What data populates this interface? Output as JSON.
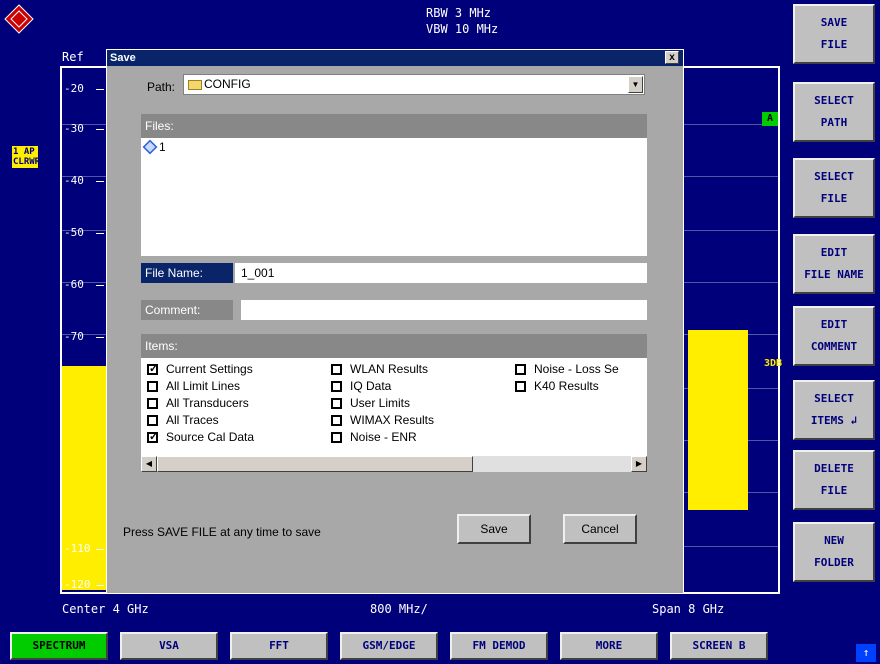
{
  "colors": {
    "screen_bg": "#00007a",
    "trace": "#ffee00",
    "dialog_bg": "#a8a8a8",
    "title_bar": "#0a246a",
    "active_tab": "#00cc00"
  },
  "header": {
    "rbw": "RBW 3 MHz",
    "vbw": "VBW 10 MHz",
    "ref": "Ref"
  },
  "y_ticks": [
    "-20",
    "-30",
    "-40",
    "-50",
    "-60",
    "-70",
    "-110",
    "-120"
  ],
  "badges": {
    "trace": "1 AP\nCLRWR",
    "marker_a": "A",
    "db": "3DB"
  },
  "footer": {
    "center": "Center  4 GHz",
    "span_per_div": "800 MHz/",
    "span": "Span  8 GHz"
  },
  "softkeys": [
    {
      "line1": "SAVE",
      "line2": "FILE"
    },
    {
      "line1": "SELECT",
      "line2": "PATH"
    },
    {
      "line1": "SELECT",
      "line2": "FILE"
    },
    {
      "line1": "EDIT",
      "line2": "FILE NAME"
    },
    {
      "line1": "EDIT",
      "line2": "COMMENT"
    },
    {
      "line1": "SELECT",
      "line2": "ITEMS  ↲"
    },
    {
      "line1": "DELETE",
      "line2": "FILE"
    },
    {
      "line1": "NEW",
      "line2": "FOLDER"
    }
  ],
  "hotkeys": [
    "SPECTRUM",
    "VSA",
    "FFT",
    "GSM/EDGE",
    "FM DEMOD",
    "MORE",
    "SCREEN B"
  ],
  "corner_icon": "up-arrow-icon",
  "dialog": {
    "title": "Save",
    "close": "x",
    "path_label": "Path:",
    "path_value": "CONFIG",
    "files_header": "Files:",
    "files": [
      "1"
    ],
    "file_name_label": "File Name:",
    "file_name_value": "1_001",
    "comment_label": "Comment:",
    "comment_value": "",
    "items_header": "Items:",
    "items": [
      {
        "label": "Current Settings",
        "checked": true
      },
      {
        "label": "All Limit Lines",
        "checked": false
      },
      {
        "label": "All Transducers",
        "checked": false
      },
      {
        "label": "All Traces",
        "checked": false
      },
      {
        "label": "Source Cal Data",
        "checked": true
      },
      {
        "label": "WLAN Results",
        "checked": false
      },
      {
        "label": "IQ Data",
        "checked": false
      },
      {
        "label": "User Limits",
        "checked": false
      },
      {
        "label": "WIMAX Results",
        "checked": false
      },
      {
        "label": "Noise - ENR",
        "checked": false
      },
      {
        "label": "Noise - Loss Se",
        "checked": false
      },
      {
        "label": "K40 Results",
        "checked": false
      }
    ],
    "hint": "Press SAVE FILE at any time to save",
    "save_button": "Save",
    "cancel_button": "Cancel"
  }
}
